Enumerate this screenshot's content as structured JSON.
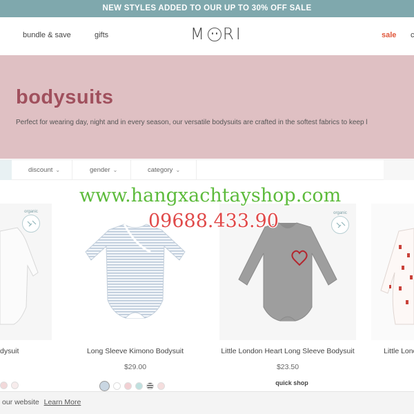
{
  "promo": {
    "text": "NEW STYLES ADDED TO OUR UP TO 30% OFF SALE"
  },
  "header": {
    "nav_left": [
      "bundle & save",
      "gifts"
    ],
    "logo": {
      "m": "M",
      "rest": "RI"
    },
    "sale": "sale",
    "cart_stub": "c",
    "colors": {
      "sale": "#e0563a"
    }
  },
  "hero": {
    "title": "bodysuits",
    "description": "Perfect for wearing day, night and in every season, our versatile bodysuits are crafted in the softest fabrics to keep l",
    "colors": {
      "background": "#dfc0c3",
      "title": "#a0505d"
    }
  },
  "filters": [
    {
      "label": "discount",
      "icon": "chevron-down-icon"
    },
    {
      "label": "gender",
      "icon": "chevron-down-icon"
    },
    {
      "label": "category",
      "icon": "chevron-down-icon"
    }
  ],
  "products": [
    {
      "name": "dysuit",
      "price": "",
      "badge": "organic"
    },
    {
      "name": "Long Sleeve Kimono Bodysuit",
      "price": "$29.00",
      "badge": ""
    },
    {
      "name": "Little London Heart Long Sleeve Bodysuit",
      "price": "$23.50",
      "badge": "organic",
      "quick_shop": "quick shop"
    },
    {
      "name": "Little Lond",
      "price": "",
      "badge": ""
    }
  ],
  "watermark": {
    "line1": "www.hangxachtayshop.com",
    "line2": "09688.433.90"
  },
  "cookie": {
    "text": "our website",
    "link": "Learn More"
  }
}
